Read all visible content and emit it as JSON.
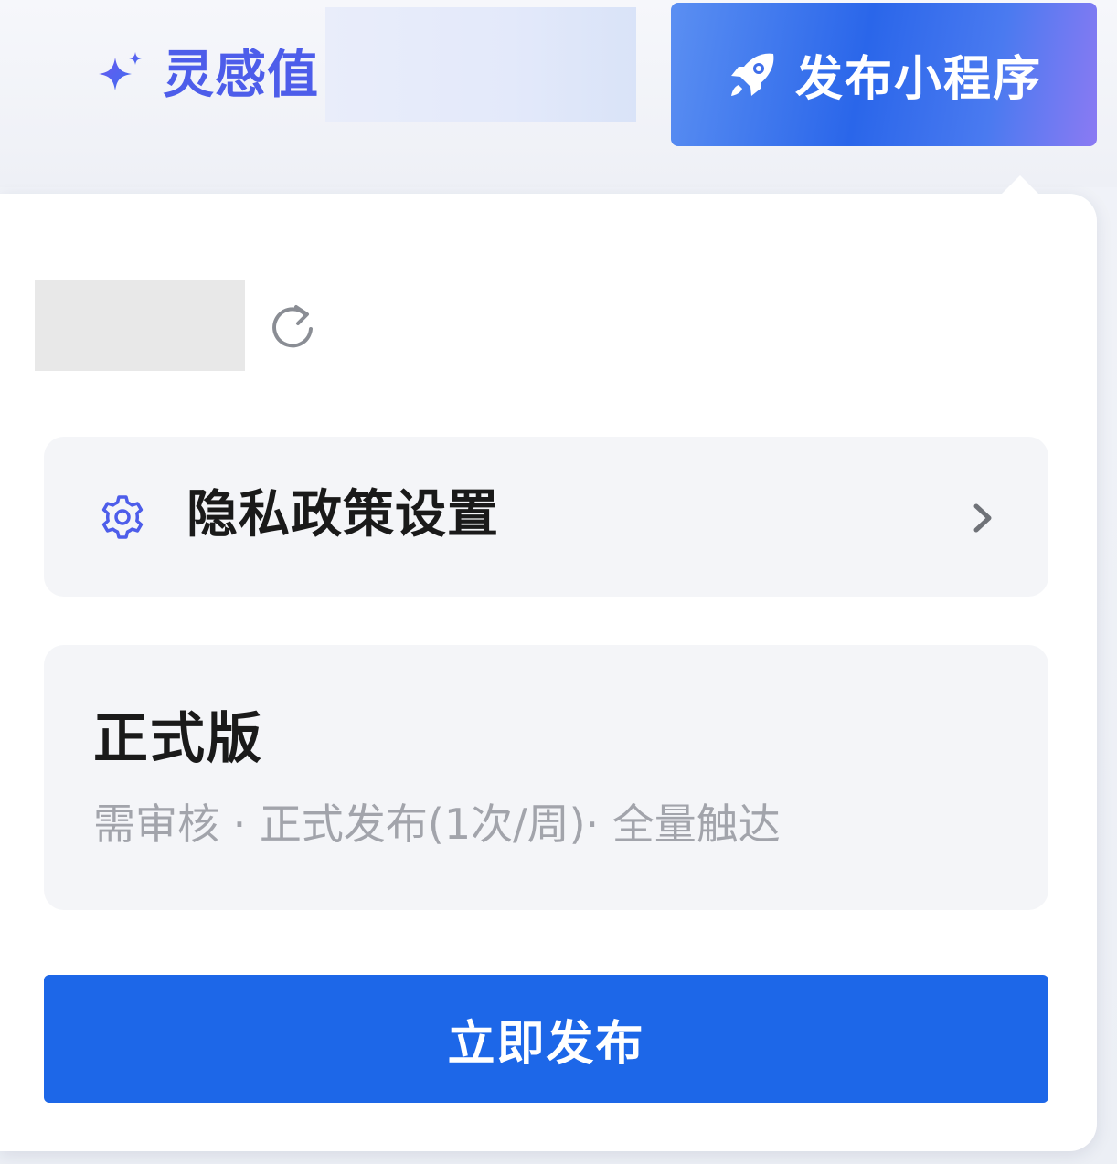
{
  "header": {
    "inspiration_label": "灵感值",
    "inspiration_icon": "sparkle-icon",
    "publish_button_label": "发布小程序",
    "publish_button_icon": "rocket-icon",
    "accent_color": "#4d5dea",
    "publish_gradient": [
      "#5b8ff2",
      "#2a66ea",
      "#8b7af3"
    ]
  },
  "popover": {
    "refresh_icon": "refresh-icon",
    "privacy": {
      "icon": "gear-icon",
      "label": "隐私政策设置",
      "trailing_icon": "chevron-right-icon"
    },
    "version": {
      "title": "正式版",
      "description": "需审核 · 正式发布(1次/周)· 全量触达"
    },
    "submit_label": "立即发布",
    "submit_color": "#1d67e8"
  }
}
